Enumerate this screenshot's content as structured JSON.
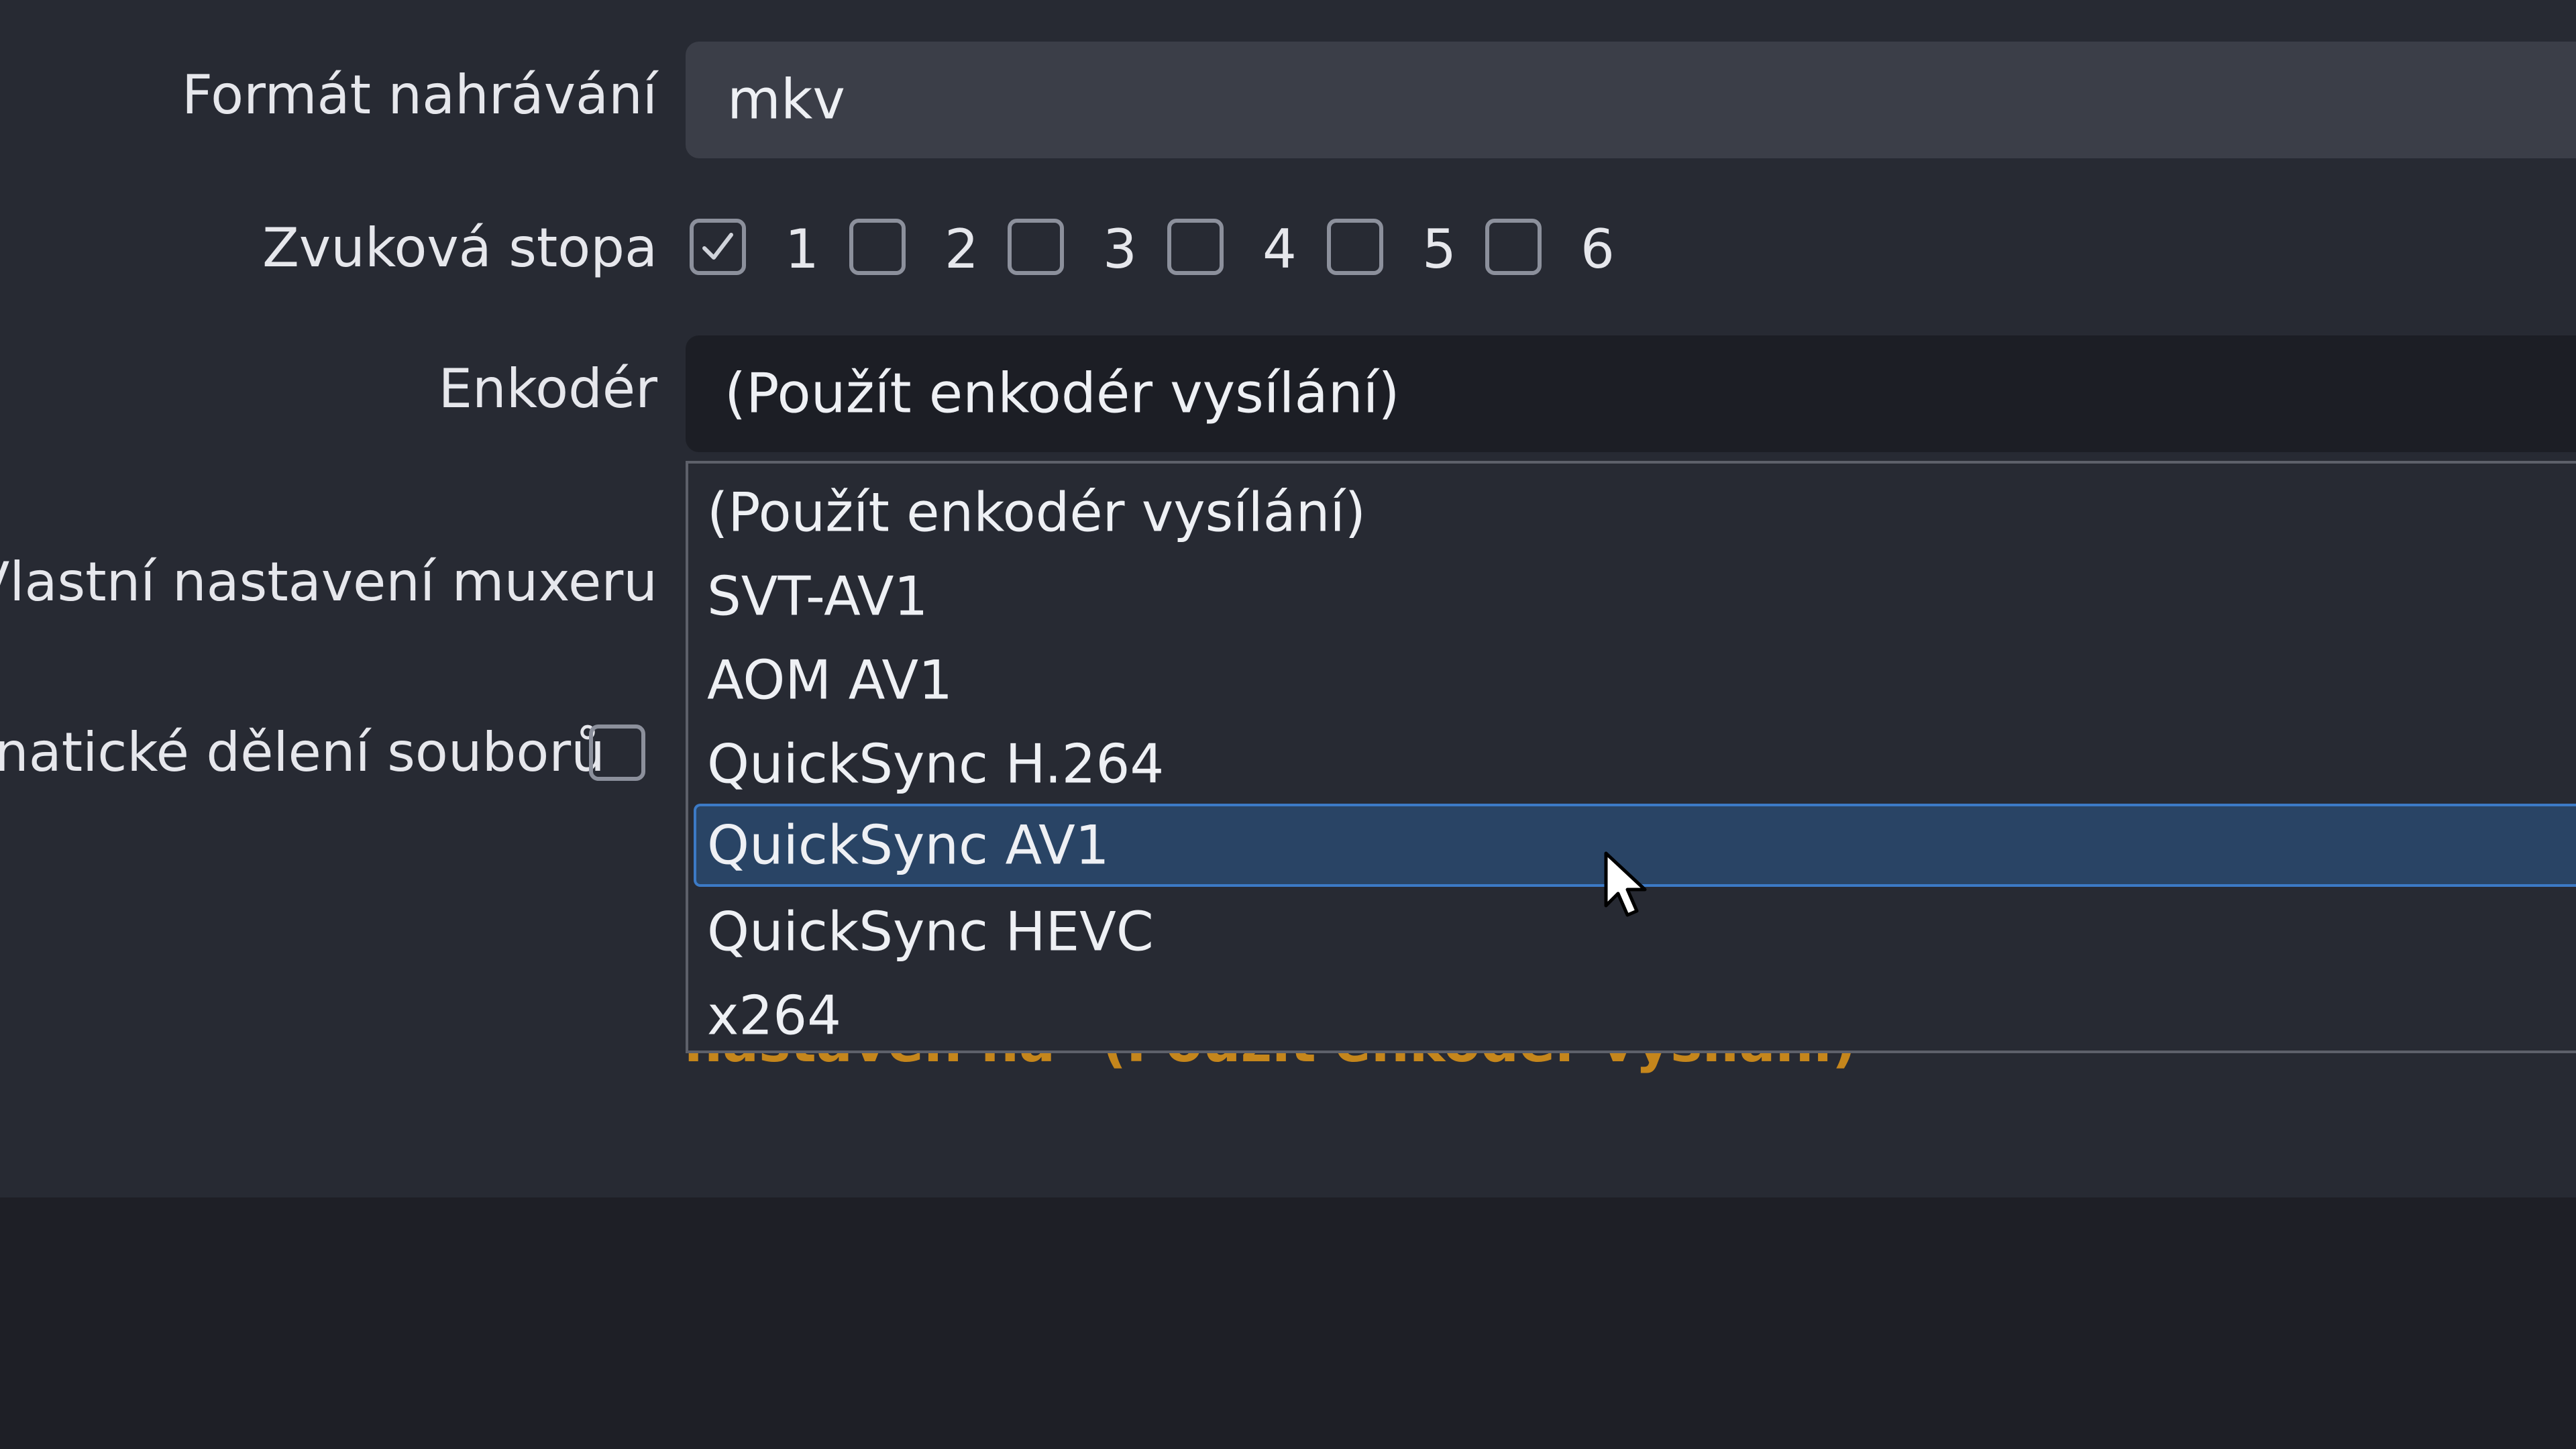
{
  "recording_format": {
    "label": "Formát nahrávání",
    "value": "mkv"
  },
  "audio_track": {
    "label": "Zvuková stopa",
    "tracks": [
      {
        "number": "1",
        "checked": true
      },
      {
        "number": "2",
        "checked": false
      },
      {
        "number": "3",
        "checked": false
      },
      {
        "number": "4",
        "checked": false
      },
      {
        "number": "5",
        "checked": false
      },
      {
        "number": "6",
        "checked": false
      }
    ]
  },
  "encoder": {
    "label": "Enkodér",
    "value": "(Použít enkodér vysílání)",
    "options": [
      "(Použít enkodér vysílání)",
      "SVT-AV1",
      "AOM AV1",
      "QuickSync H.264",
      "QuickSync AV1",
      "QuickSync HEVC",
      "x264"
    ],
    "highlighted_option": "QuickSync AV1"
  },
  "muxer": {
    "label": "Vlastní nastavení muxeru"
  },
  "file_split": {
    "label": "natické dělení souborů",
    "checked": false
  },
  "warning_text": "nastaven na \"(Použít enkodér vysílání)\"",
  "colors": {
    "panel_bg": "#272a33",
    "outer_bg": "#1e1f26",
    "selected_bg": "#294465",
    "selected_border": "#3c7ac6",
    "warning": "#c5861c"
  }
}
